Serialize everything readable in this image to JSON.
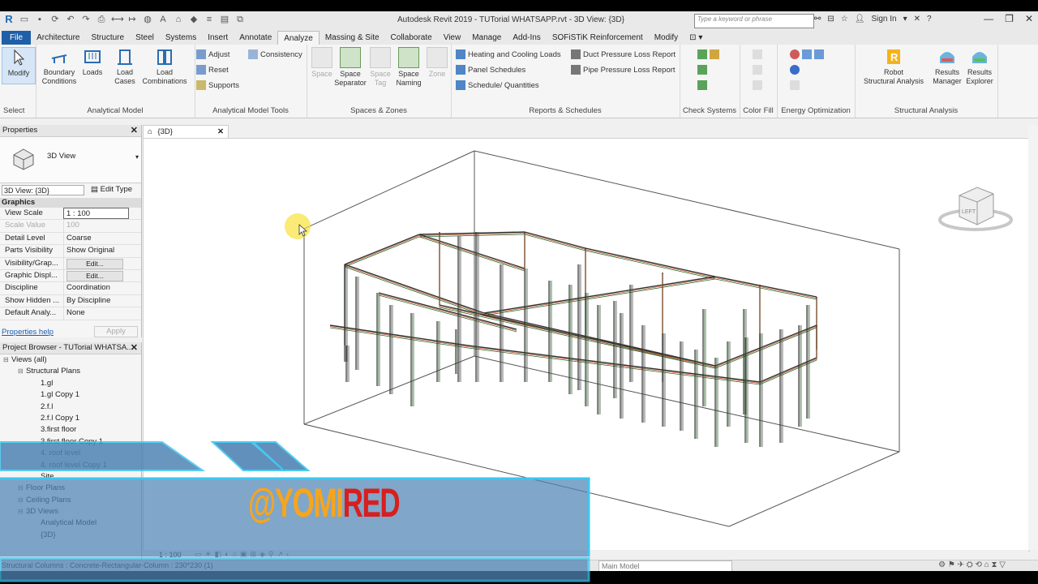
{
  "app": {
    "window_title": "Autodesk Revit 2019 - TUTorial WHATSAPP.rvt - 3D View: {3D}",
    "search_placeholder": "Type a keyword or phrase",
    "sign_in": "Sign In"
  },
  "menu_tabs": [
    "File",
    "Architecture",
    "Structure",
    "Steel",
    "Systems",
    "Insert",
    "Annotate",
    "Analyze",
    "Massing & Site",
    "Collaborate",
    "View",
    "Manage",
    "Add-Ins",
    "SOFiSTiK Reinforcement",
    "Modify"
  ],
  "active_tab": "Analyze",
  "ribbon": {
    "select": {
      "modify": "Modify",
      "label": "Select"
    },
    "analytical_model": {
      "label": "Analytical Model",
      "buttons": [
        "Boundary\nConditions",
        "Loads",
        "Load\nCases",
        "Load\nCombinations"
      ]
    },
    "analytical_model_tools": {
      "label": "Analytical Model Tools",
      "adjust": "Adjust",
      "consistency": "Consistency",
      "reset": "Reset",
      "supports": "Supports"
    },
    "spaces_zones": {
      "label": "Spaces & Zones",
      "buttons": [
        "Space",
        "Space\nSeparator",
        "Space\nTag",
        "Space\nNaming",
        "Zone"
      ]
    },
    "reports": {
      "label": "Reports & Schedules",
      "heating": "Heating and Cooling Loads",
      "panel": "Panel Schedules",
      "schedule": "Schedule/ Quantities",
      "duct": "Duct Pressure Loss Report",
      "pipe": "Pipe Pressure Loss Report"
    },
    "check_systems": "Check Systems",
    "color_fill": "Color Fill",
    "energy": "Energy Optimization",
    "structural_analysis": {
      "label": "Structural Analysis",
      "robot": "Robot\nStructural Analysis",
      "results_manager": "Results\nManager",
      "results_explorer": "Results\nExplorer"
    }
  },
  "properties": {
    "title": "Properties",
    "type_name": "3D View",
    "view_selector": "3D View: {3D}",
    "edit_type": "Edit Type",
    "group": "Graphics",
    "rows": [
      {
        "k": "View Scale",
        "v": "1 : 100"
      },
      {
        "k": "Scale Value",
        "v": "100"
      },
      {
        "k": "Detail Level",
        "v": "Coarse"
      },
      {
        "k": "Parts Visibility",
        "v": "Show Original"
      },
      {
        "k": "Visibility/Grap...",
        "v": "Edit..."
      },
      {
        "k": "Graphic Displ...",
        "v": "Edit..."
      },
      {
        "k": "Discipline",
        "v": "Coordination"
      },
      {
        "k": "Show Hidden ...",
        "v": "By Discipline"
      },
      {
        "k": "Default Analy...",
        "v": "None"
      }
    ],
    "help": "Properties help",
    "apply": "Apply"
  },
  "browser": {
    "title": "Project Browser - TUTorial WHATSA...",
    "nodes": [
      "Views (all)",
      "Structural Plans",
      "1.gl",
      "1.gl Copy 1",
      "2.f.l",
      "2.f.l Copy 1",
      "3.first floor",
      "3.first floor Copy 1",
      "4. roof level",
      "4. roof level Copy 1",
      "Site",
      "Floor Plans",
      "Ceiling Plans",
      "3D Views",
      "Analytical Model",
      "{3D}"
    ]
  },
  "view": {
    "tab": "{3D}",
    "scale": "1 : 100",
    "viewcube_face": "LEFT"
  },
  "status": {
    "text": "Structural Columns : Concrete-Rectangular-Column : 230*230 (1)",
    "model": "Main Model"
  },
  "watermark": {
    "part1": "@YOMI",
    "part2": "RED"
  },
  "colors": {
    "file_tab": "#1f5fa8",
    "overlay_fill": "#4f84b4",
    "overlay_border": "#3ec6ef",
    "wm_orange": "#f7a51c",
    "wm_red": "#d81f1f"
  }
}
